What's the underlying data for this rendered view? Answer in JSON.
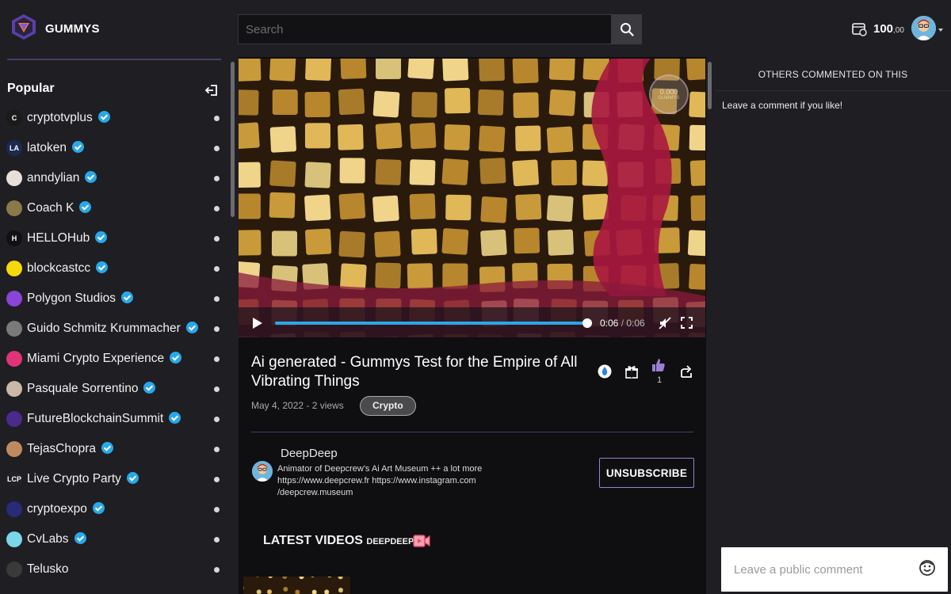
{
  "header": {
    "brand": "GUMMYS",
    "search_placeholder": "Search",
    "balance_main": "100",
    "balance_cents": ",00"
  },
  "sidebar": {
    "title": "Popular",
    "channels": [
      {
        "name": "cryptotvplus",
        "verified": true,
        "avatar_color": "#1a1a1a",
        "avatar_text": "C"
      },
      {
        "name": "latoken",
        "verified": true,
        "avatar_color": "#1b2a52",
        "avatar_text": "LA"
      },
      {
        "name": "anndylian",
        "verified": true,
        "avatar_color": "#e8e0d8",
        "avatar_text": ""
      },
      {
        "name": "Coach K",
        "verified": true,
        "avatar_color": "#8a7a4a",
        "avatar_text": ""
      },
      {
        "name": "HELLOHub",
        "verified": true,
        "avatar_color": "#111111",
        "avatar_text": "H"
      },
      {
        "name": "blockcastcc",
        "verified": true,
        "avatar_color": "#f5d90a",
        "avatar_text": ""
      },
      {
        "name": "Polygon Studios",
        "verified": true,
        "avatar_color": "#8a44d6",
        "avatar_text": ""
      },
      {
        "name": "Guido Schmitz Krummacher",
        "verified": true,
        "avatar_color": "#7a7a7a",
        "avatar_text": ""
      },
      {
        "name": "Miami Crypto Experience",
        "verified": true,
        "avatar_color": "#e0337a",
        "avatar_text": ""
      },
      {
        "name": "Pasquale Sorrentino",
        "verified": true,
        "avatar_color": "#c9b8a8",
        "avatar_text": ""
      },
      {
        "name": "FutureBlockchainSummit",
        "verified": true,
        "avatar_color": "#4a2a8a",
        "avatar_text": ""
      },
      {
        "name": "TejasChopra",
        "verified": true,
        "avatar_color": "#c08a60",
        "avatar_text": ""
      },
      {
        "name": "Live Crypto Party",
        "verified": true,
        "avatar_color": "#222222",
        "avatar_text": "LCP"
      },
      {
        "name": "cryptoexpo",
        "verified": true,
        "avatar_color": "#2a2a7a",
        "avatar_text": ""
      },
      {
        "name": "CvLabs",
        "verified": true,
        "avatar_color": "#7ad6e8",
        "avatar_text": ""
      },
      {
        "name": "Telusko",
        "verified": false,
        "avatar_color": "#3a3a3a",
        "avatar_text": ""
      }
    ]
  },
  "video": {
    "gummy_value": "0.000",
    "gummy_label": "GUMMYS",
    "progress": 1.0,
    "time_current": "0:06",
    "time_separator": " / ",
    "time_total": "0:06",
    "title": "Ai generated - Gummys Test for the Empire of All Vibrating Things",
    "meta": "May 4, 2022 - 2 views",
    "tag": "Crypto",
    "like_count": "1"
  },
  "creator": {
    "name": "DeepDeep",
    "bio": "Animator of Deepcrew's Ai Art Museum ++ a lot more https://www.deepcrew.fr https://www.instagram.com /deepcrew.museum",
    "unsubscribe_label": "UNSUBSCRIBE"
  },
  "latest": {
    "title": "LATEST VIDEOS",
    "channel": "DEEPDEEP"
  },
  "comments": {
    "header": "OTHERS COMMENTED ON THIS",
    "empty_text": "Leave a comment if you like!",
    "input_placeholder": "Leave a public comment"
  },
  "colors": {
    "accent_blue": "#29a8e9",
    "accent_purple": "#9c7fd4",
    "background": "#1f1e22"
  }
}
